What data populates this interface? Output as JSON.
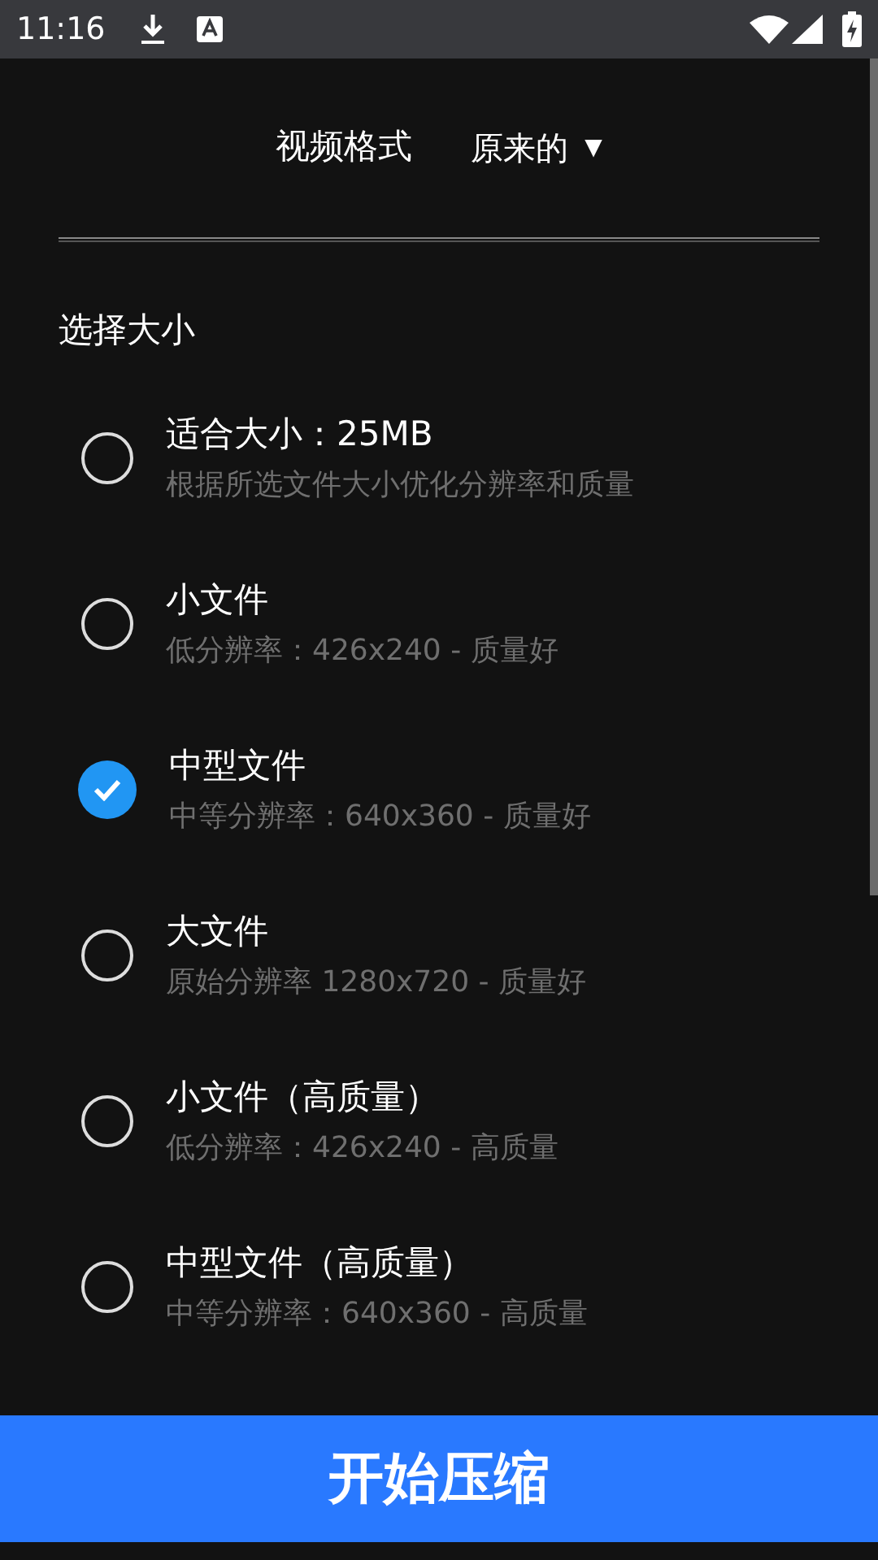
{
  "status_bar": {
    "time": "11:16"
  },
  "format": {
    "label": "视频格式",
    "value": "原来的",
    "arrow": "▼"
  },
  "section_title": "选择大小",
  "options": [
    {
      "title": "适合大小：25MB",
      "subtitle": "根据所选文件大小优化分辨率和质量",
      "selected": false
    },
    {
      "title": "小文件",
      "subtitle": "低分辨率：426x240 - 质量好",
      "selected": false
    },
    {
      "title": "中型文件",
      "subtitle": "中等分辨率：640x360 - 质量好",
      "selected": true
    },
    {
      "title": "大文件",
      "subtitle": "原始分辨率 1280x720 - 质量好",
      "selected": false
    },
    {
      "title": "小文件（高质量）",
      "subtitle": "低分辨率：426x240 - 高质量",
      "selected": false
    },
    {
      "title": "中型文件（高质量）",
      "subtitle": "中等分辨率：640x360 - 高质量",
      "selected": false
    }
  ],
  "start_button": "开始压缩"
}
